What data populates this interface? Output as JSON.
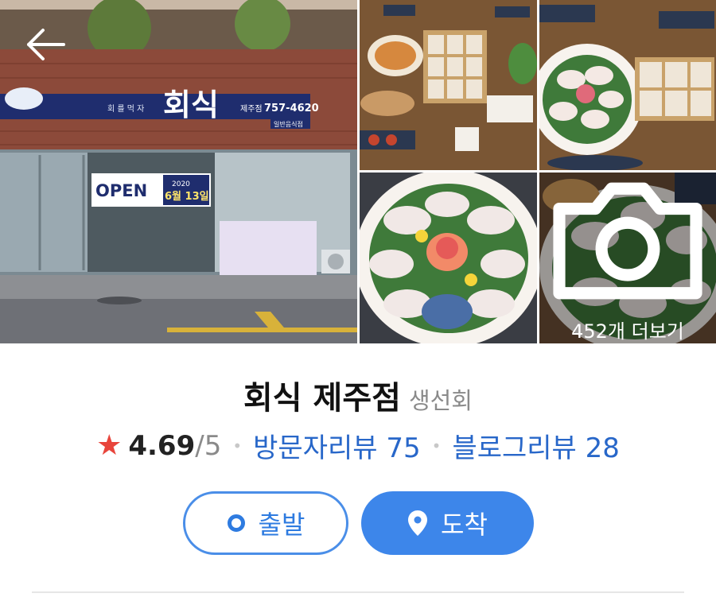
{
  "gallery": {
    "more_label": "452개 더보기",
    "storefront": {
      "sign_title": "회식",
      "sign_small": "회 를 먹 자",
      "sign_phone_prefix": "제주점",
      "sign_phone": "757-4620",
      "sign_sub": "일반음식점",
      "banner_open": "OPEN",
      "banner_year": "2020",
      "banner_date": "6월 13일"
    }
  },
  "place": {
    "name": "회식 제주점",
    "category": "생선회"
  },
  "rating": {
    "star": "★",
    "score": "4.69",
    "slash": "/",
    "max": "5",
    "visitor_reviews": "방문자리뷰 75",
    "blog_reviews": "블로그리뷰 28"
  },
  "actions": {
    "start_label": "출발",
    "arrive_label": "도착"
  },
  "colors": {
    "accent": "#3d86ea",
    "link": "#2867c9",
    "star": "#e8453c"
  }
}
